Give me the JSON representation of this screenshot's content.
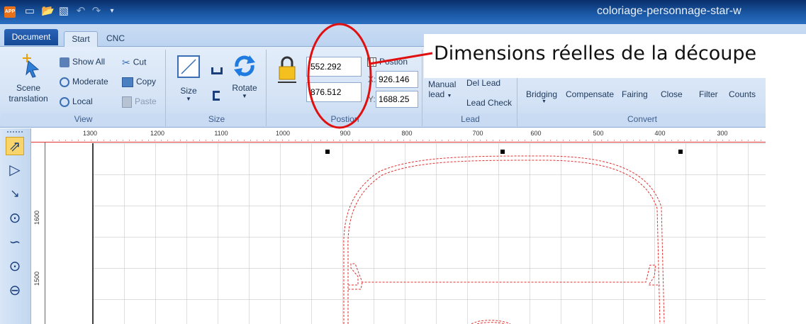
{
  "window": {
    "title": "coloriage-personnage-star-w",
    "logo_text": "APP"
  },
  "tabs": [
    "Document",
    "Start",
    "CNC"
  ],
  "view_group": {
    "label": "View",
    "scene_translation": "Scene translation",
    "scene_line1": "Scene",
    "scene_line2": "translation",
    "show_all": "Show All",
    "moderate": "Moderate",
    "local": "Local",
    "cut": "Cut",
    "copy": "Copy",
    "paste": "Paste"
  },
  "size_group": {
    "label": "Size",
    "size": "Size",
    "rotate": "Rotate"
  },
  "position_group": {
    "label": "Postion",
    "width_value": "552.292",
    "height_value": "876.512",
    "position_label": "Postion",
    "x_value": "926.146",
    "y_value": "1688.25",
    "x_prefix": "X:",
    "y_prefix": "Y:"
  },
  "lead_group": {
    "label": "Lead",
    "manual_lead_1": "Manual",
    "manual_lead_2": "lead",
    "del_lead": "Del Lead",
    "lead_check": "Lead Check"
  },
  "convert_group": {
    "label": "Convert",
    "items": [
      "Bridging",
      "Compensate",
      "Fairing",
      "Close",
      "Filter",
      "Counts"
    ]
  },
  "annotation": {
    "text": "Dimensions réelles de la découpe"
  },
  "ruler": {
    "h_labels": [
      "1300",
      "1200",
      "1100",
      "1000",
      "900",
      "800",
      "700",
      "600",
      "500",
      "400",
      "300"
    ],
    "v_labels": [
      "1600",
      "1500"
    ]
  },
  "colors": {
    "ribbon": "#d3e2f5",
    "accent_red": "#e01010",
    "path_red": "#e03030"
  }
}
